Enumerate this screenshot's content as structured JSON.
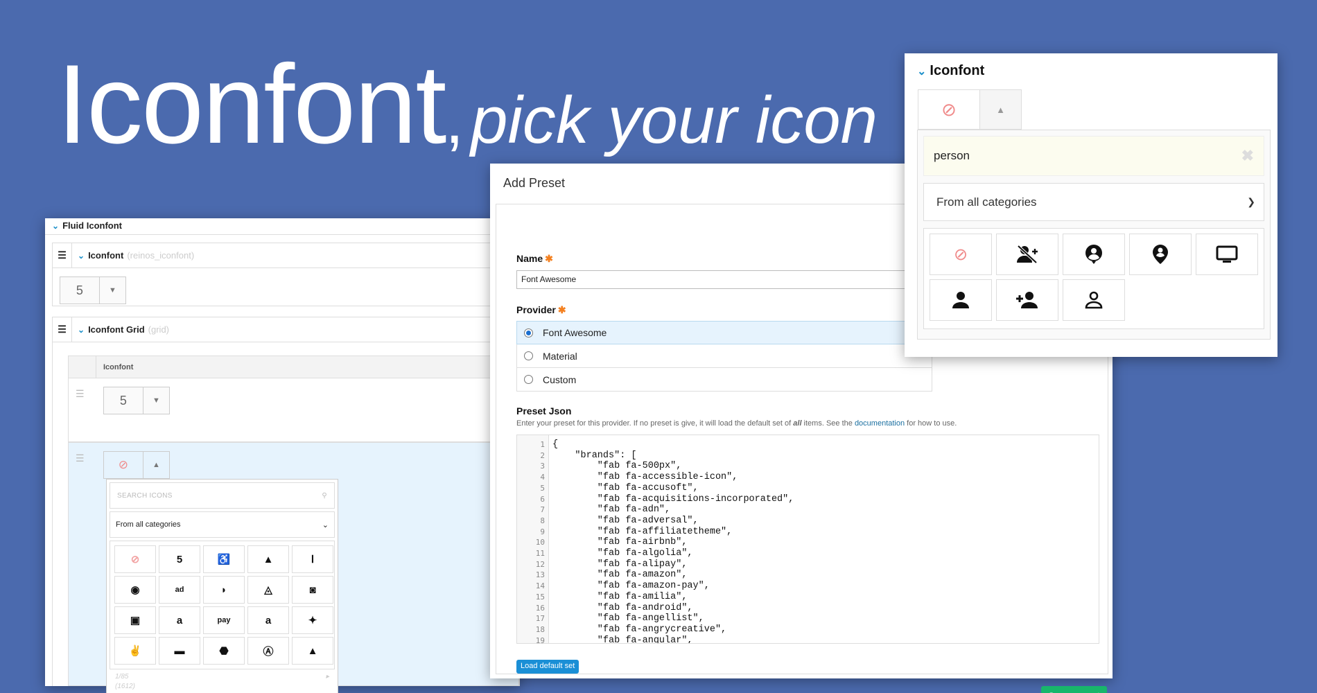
{
  "hero": {
    "title": "Iconfont",
    "comma": ",",
    "subtitle": "pick your icon"
  },
  "left_panel": {
    "header": "Fluid Iconfont",
    "section1": {
      "title": "Iconfont",
      "hint": "(reinos_iconfont)"
    },
    "section2": {
      "title": "Iconfont Grid",
      "hint": "(grid)"
    },
    "grid_header": "Iconfont",
    "search_placeholder": "SEARCH ICONS",
    "category_select": "From all categories",
    "icons": [
      "⊘",
      "5",
      "♿",
      "▲",
      "Ⅰ",
      "◉",
      "ad",
      "◗",
      "◬",
      "◙",
      "▣",
      "a",
      "pay",
      "a",
      "✦",
      "✌",
      "▬",
      "⬣",
      "Ⓐ",
      "▲"
    ],
    "pagination": "1/85",
    "total": "(1612)"
  },
  "middle_panel": {
    "title": "Add Preset",
    "name_label": "Name",
    "name_value": "Font Awesome",
    "provider_label": "Provider",
    "providers": [
      "Font Awesome",
      "Material",
      "Custom"
    ],
    "preset_label": "Preset Json",
    "desc_before": "Enter your preset for this provider. If no preset is give, it will load the default set of ",
    "desc_em": "all",
    "desc_mid": " items. See the ",
    "desc_link": "documentation",
    "desc_after": " for how to use.",
    "code_lines": [
      "{",
      "    \"brands\": [",
      "        \"fab fa-500px\",",
      "        \"fab fa-accessible-icon\",",
      "        \"fab fa-accusoft\",",
      "        \"fab fa-acquisitions-incorporated\",",
      "        \"fab fa-adn\",",
      "        \"fab fa-adversal\",",
      "        \"fab fa-affiliatetheme\",",
      "        \"fab fa-airbnb\",",
      "        \"fab fa-algolia\",",
      "        \"fab fa-alipay\",",
      "        \"fab fa-amazon\",",
      "        \"fab fa-amazon-pay\",",
      "        \"fab fa-amilia\",",
      "        \"fab fa-android\",",
      "        \"fab fa-angellist\",",
      "        \"fab fa-angrycreative\",",
      "        \"fab fa-angular\","
    ],
    "load_button": "Load default set",
    "save_button": "Save preset"
  },
  "right_panel": {
    "title": "Iconfont",
    "search_value": "person",
    "category_select": "From all categories",
    "icons": [
      "ban-icon",
      "person-slash-icon",
      "user-circle-icon",
      "map-pin-user-icon",
      "monitor-icon",
      "person-icon",
      "person-add-icon",
      "person-outline-icon"
    ]
  },
  "colors": {
    "background": "#4b6aae",
    "accent": "#1a8fc9",
    "save": "#18b66b",
    "required": "#f4801f"
  }
}
